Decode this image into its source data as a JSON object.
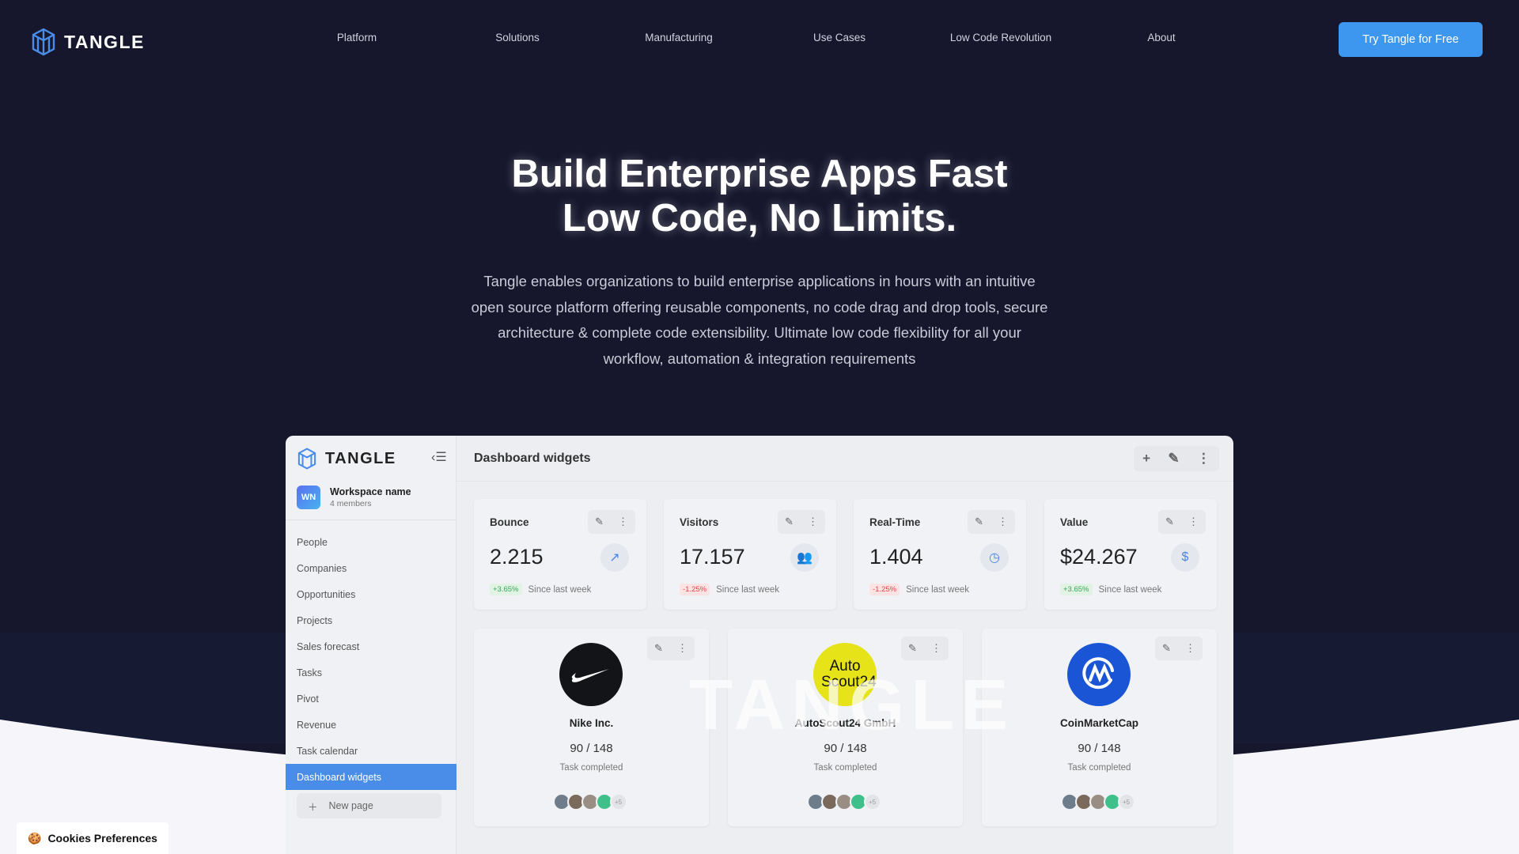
{
  "header": {
    "brand": "TANGLE",
    "nav": [
      "Platform",
      "Solutions",
      "Manufacturing",
      "Use Cases",
      "Low Code Revolution",
      "About"
    ],
    "cta": "Try Tangle for Free",
    "accent": "#3d97ee"
  },
  "hero": {
    "title_line1": "Build Enterprise Apps Fast",
    "title_line2": "Low Code, No Limits.",
    "description": "Tangle enables organizations to build enterprise applications in hours with an intuitive open source platform offering reusable components, no code drag and drop tools, secure architecture & complete code extensibility. Ultimate low code flexibility for all your workflow, automation & integration requirements"
  },
  "app": {
    "brand": "TANGLE",
    "watermark": "TANGLE",
    "workspace": {
      "initials": "WN",
      "name": "Workspace name",
      "members": "4 members"
    },
    "sidebar": [
      "People",
      "Companies",
      "Opportunities",
      "Projects",
      "Sales forecast",
      "Tasks",
      "Pivot",
      "Revenue",
      "Task calendar",
      "Dashboard widgets"
    ],
    "active": "Dashboard widgets",
    "new_page": "New page",
    "page_title": "Dashboard widgets",
    "kpis": [
      {
        "title": "Bounce",
        "value": "2.215",
        "change": "+3.65%",
        "trend": "up",
        "icon": "arrow-up-right-icon",
        "glyph": "↗",
        "since": "Since last week"
      },
      {
        "title": "Visitors",
        "value": "17.157",
        "change": "-1.25%",
        "trend": "down",
        "icon": "users-icon",
        "glyph": "👥",
        "since": "Since last week"
      },
      {
        "title": "Real-Time",
        "value": "1.404",
        "change": "-1.25%",
        "trend": "down",
        "icon": "clock-icon",
        "glyph": "◷",
        "since": "Since last week"
      },
      {
        "title": "Value",
        "value": "$24.267",
        "change": "+3.65%",
        "trend": "up",
        "icon": "dollar-icon",
        "glyph": "$",
        "since": "Since last week"
      }
    ],
    "companies": [
      {
        "name": "Nike Inc.",
        "count": "90 / 148",
        "label": "Task completed",
        "extra": "+5",
        "logo_text": ""
      },
      {
        "name": "AutoScout24 GmbH",
        "count": "90 / 148",
        "label": "Task completed",
        "extra": "+5",
        "logo_text": "Auto Scout24"
      },
      {
        "name": "CoinMarketCap",
        "count": "90 / 148",
        "label": "Task completed",
        "extra": "+5",
        "logo_text": ""
      }
    ]
  },
  "cookies": {
    "label": "Cookies Preferences"
  }
}
